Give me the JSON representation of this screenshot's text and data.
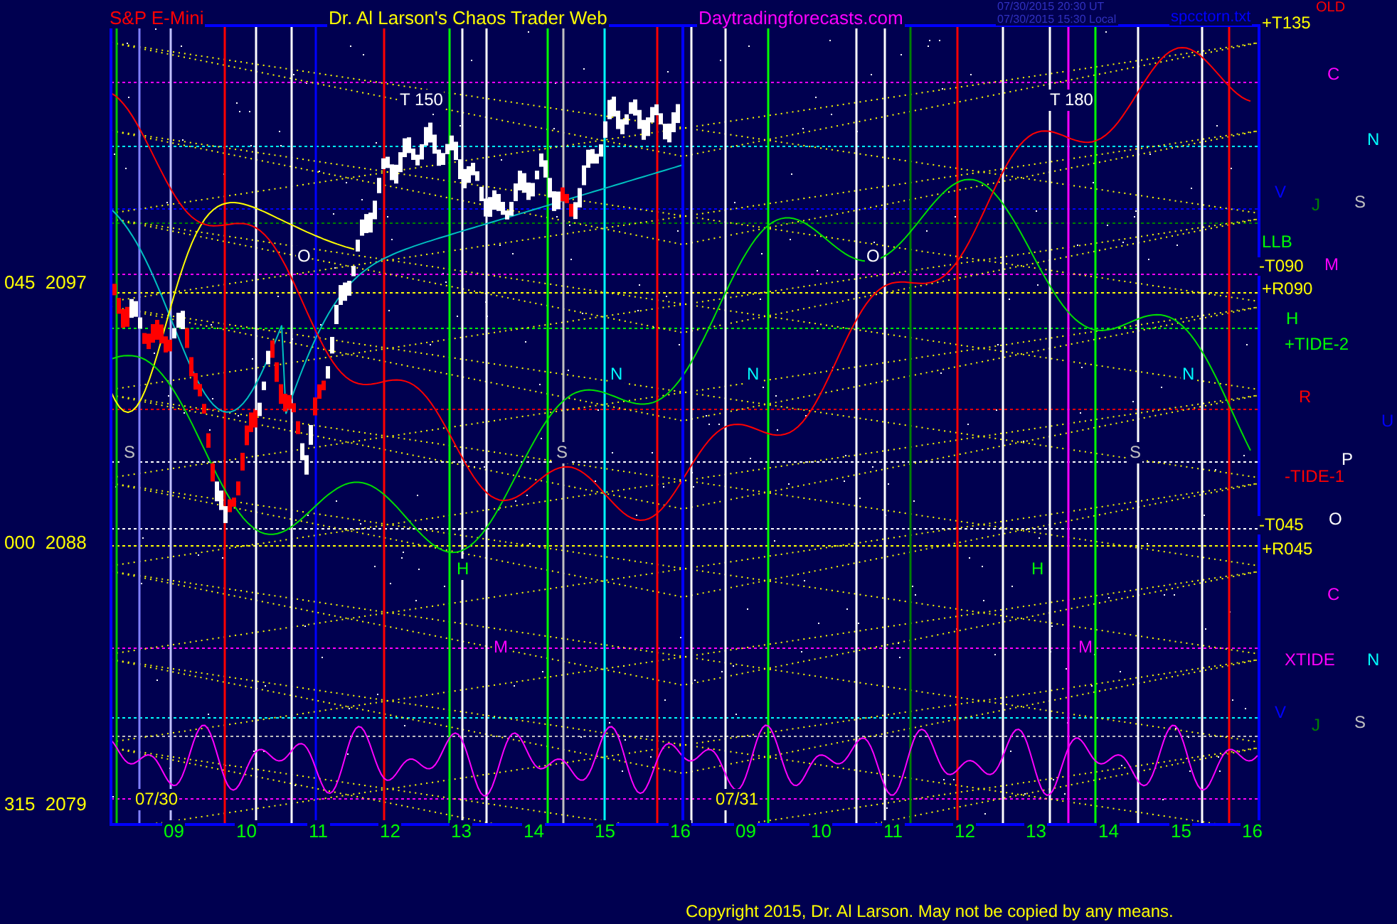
{
  "header": {
    "symbol": "S&P E-Mini",
    "title": "Dr. Al Larson's Chaos Trader Web",
    "site": "Daytradingforecasts.com",
    "time_ut": "07/30/2015 20:30 UT",
    "time_local": "07/30/2015 15:30 Local",
    "file": "spcctorn.txt",
    "flag": "OLD"
  },
  "y_labels": [
    {
      "angle": "045",
      "price": "2097"
    },
    {
      "angle": "000",
      "price": "2088"
    },
    {
      "angle": "315",
      "price": "2079"
    }
  ],
  "dates": [
    "07/30",
    "07/31"
  ],
  "x_ticks": [
    "09",
    "10",
    "11",
    "12",
    "13",
    "14",
    "15",
    "16",
    "09",
    "10",
    "11",
    "12",
    "13",
    "14",
    "15",
    "16"
  ],
  "plot_labels": [
    {
      "text": "T  150",
      "color": "#ffffff"
    },
    {
      "text": "T  180",
      "color": "#ffffff"
    },
    {
      "text": "O",
      "color": "#ffffff"
    },
    {
      "text": "O",
      "color": "#ffffff"
    },
    {
      "text": "N",
      "color": "#00ffff"
    },
    {
      "text": "N",
      "color": "#00ffff"
    },
    {
      "text": "N",
      "color": "#00ffff"
    },
    {
      "text": "S",
      "color": "#c0c0c0"
    },
    {
      "text": "S",
      "color": "#c0c0c0"
    },
    {
      "text": "S",
      "color": "#c0c0c0"
    },
    {
      "text": "H",
      "color": "#00ff00"
    },
    {
      "text": "H",
      "color": "#00ff00"
    },
    {
      "text": "M",
      "color": "#ff00ff"
    },
    {
      "text": "M",
      "color": "#ff00ff"
    }
  ],
  "right_labels": [
    {
      "text": "+T135",
      "color": "#ffff00"
    },
    {
      "text": "C",
      "color": "#ff00ff"
    },
    {
      "text": "N",
      "color": "#00ffff"
    },
    {
      "text": "V",
      "color": "#0000ff"
    },
    {
      "text": "J",
      "color": "#008000"
    },
    {
      "text": "S",
      "color": "#c0c0c0"
    },
    {
      "text": "LLB",
      "color": "#00ff00"
    },
    {
      "text": "M",
      "color": "#ff00ff"
    },
    {
      "text": "-T090",
      "color": "#ffff00"
    },
    {
      "text": "+R090",
      "color": "#ffff00"
    },
    {
      "text": "H",
      "color": "#00ff00"
    },
    {
      "text": "+TIDE-2",
      "color": "#00ff00"
    },
    {
      "text": "R",
      "color": "#ff0000"
    },
    {
      "text": "U",
      "color": "#0000ff"
    },
    {
      "text": "P",
      "color": "#ffffff"
    },
    {
      "text": "-TIDE-1",
      "color": "#ff0000"
    },
    {
      "text": "O",
      "color": "#ffffff"
    },
    {
      "text": "-T045",
      "color": "#ffff00"
    },
    {
      "text": "+R045",
      "color": "#ffff00"
    },
    {
      "text": "C",
      "color": "#ff00ff"
    },
    {
      "text": "XTIDE",
      "color": "#ff00ff"
    },
    {
      "text": "N",
      "color": "#00ffff"
    },
    {
      "text": "V",
      "color": "#0000ff"
    },
    {
      "text": "J",
      "color": "#008000"
    },
    {
      "text": "S",
      "color": "#c0c0c0"
    }
  ],
  "copyright": "Copyright 2015, Dr. Al Larson. May not be copied by any means."
}
